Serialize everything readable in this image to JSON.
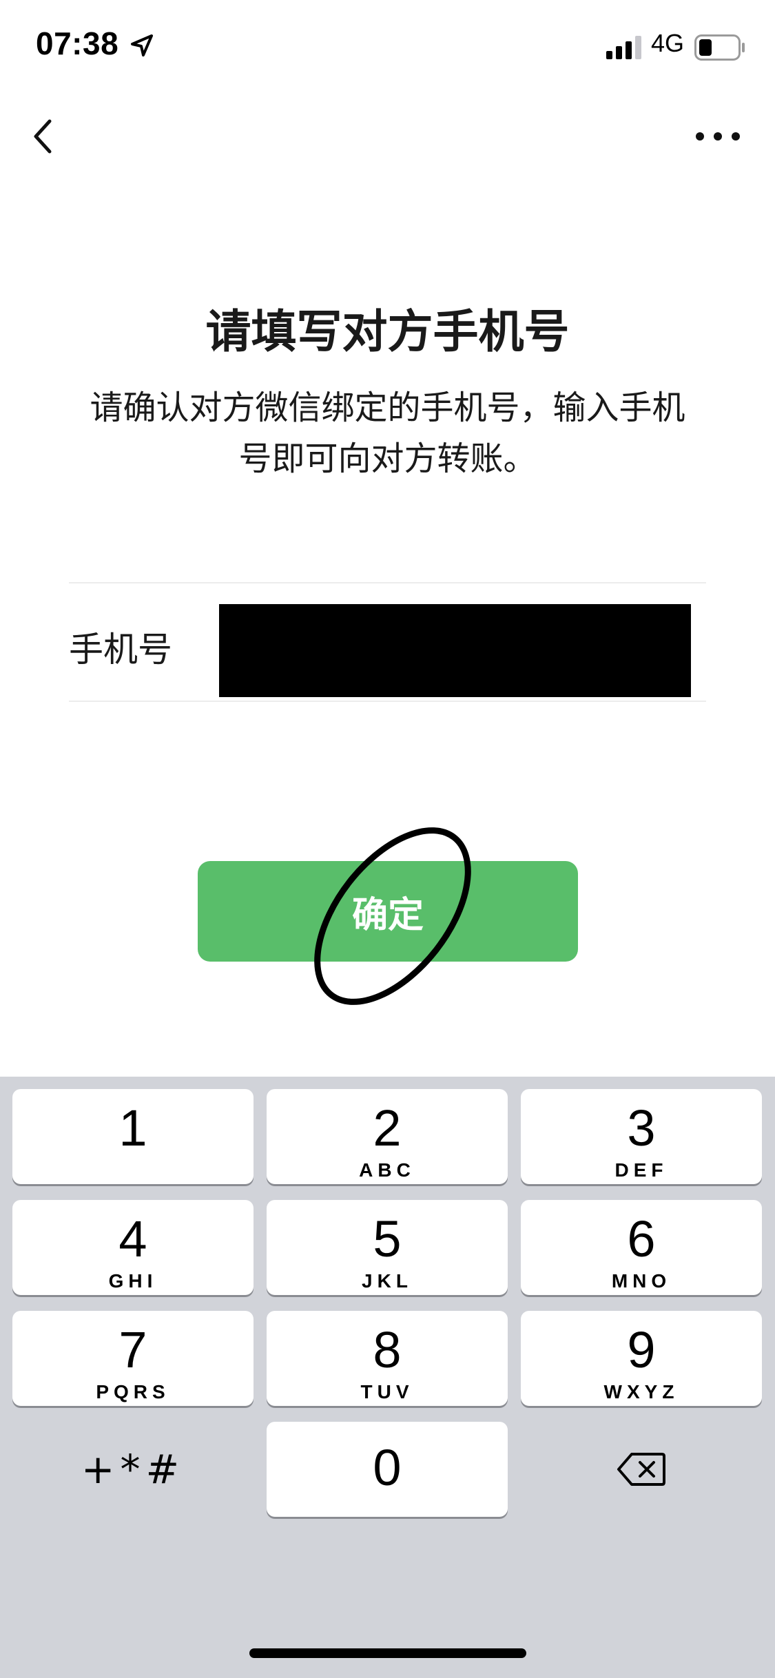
{
  "status_bar": {
    "time": "07:38",
    "network": "4G",
    "icons": [
      "location-icon",
      "signal-icon",
      "battery-icon"
    ]
  },
  "nav": {
    "icons": [
      "back-icon",
      "more-icon"
    ]
  },
  "heading": {
    "title": "请填写对方手机号",
    "description": "请确认对方微信绑定的手机号，输入手机号即可向对方转账。"
  },
  "phone_field": {
    "label": "手机号",
    "value": ""
  },
  "confirm_button": {
    "label": "确定",
    "color": "#59be6a"
  },
  "keypad": {
    "keys": [
      {
        "digit": "1",
        "letters": ""
      },
      {
        "digit": "2",
        "letters": "ABC"
      },
      {
        "digit": "3",
        "letters": "DEF"
      },
      {
        "digit": "4",
        "letters": "GHI"
      },
      {
        "digit": "5",
        "letters": "JKL"
      },
      {
        "digit": "6",
        "letters": "MNO"
      },
      {
        "digit": "7",
        "letters": "PQRS"
      },
      {
        "digit": "8",
        "letters": "TUV"
      },
      {
        "digit": "9",
        "letters": "WXYZ"
      },
      {
        "digit": "0",
        "letters": ""
      }
    ],
    "symbols": "+*#",
    "delete_icon": "backspace-icon",
    "background": "#d1d3d9"
  }
}
